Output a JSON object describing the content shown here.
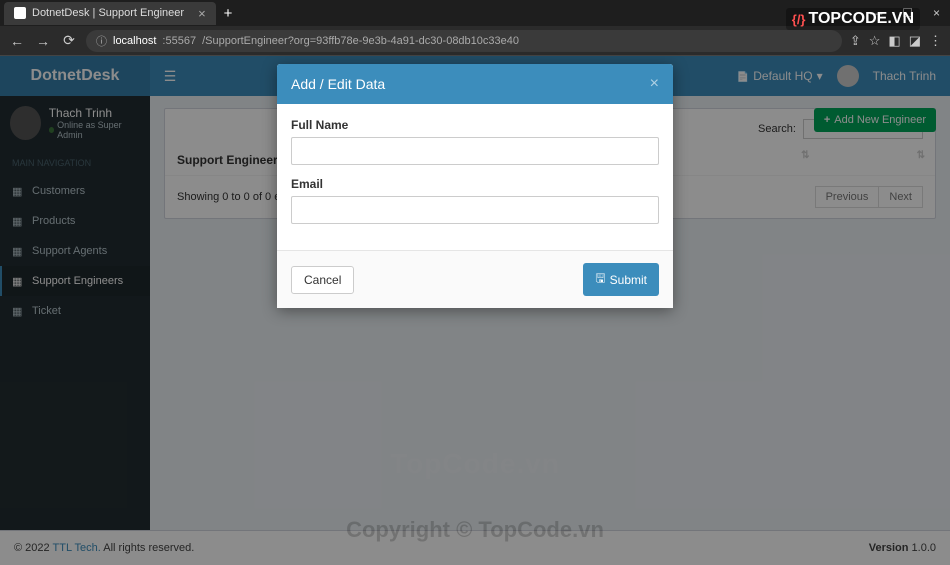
{
  "browser": {
    "tab_title": "DotnetDesk | Support Engineer",
    "url_host": "localhost",
    "url_port": ":55567",
    "url_path": "/SupportEngineer?org=93ffb78e-9e3b-4a91-dc30-08db10c33e40"
  },
  "topbar": {
    "brand": "DotnetDesk",
    "default_hq": "Default HQ",
    "user": "Thach Trinh"
  },
  "sidebar": {
    "user_name": "Thach Trinh",
    "user_status": "Online as Super Admin",
    "header": "MAIN NAVIGATION",
    "items": [
      {
        "label": "Customers"
      },
      {
        "label": "Products"
      },
      {
        "label": "Support Agents"
      },
      {
        "label": "Support Engineers"
      },
      {
        "label": "Ticket"
      }
    ]
  },
  "content": {
    "add_button": "Add New Engineer",
    "search_label": "Search:",
    "col1": "Support Engineer",
    "entries_info": "Showing 0 to 0 of 0 entries",
    "prev": "Previous",
    "next": "Next"
  },
  "modal": {
    "title": "Add / Edit Data",
    "label_fullname": "Full Name",
    "label_email": "Email",
    "cancel": "Cancel",
    "submit": "Submit"
  },
  "footer": {
    "copyright_prefix": "© 2022 ",
    "company": "TTL Tech.",
    "rights": " All rights reserved.",
    "version_label": "Version ",
    "version": "1.0.0"
  },
  "watermark": {
    "tc": "TopCode.vn",
    "cp": "Copyright © TopCode.vn",
    "logo": "TOPCODE.VN"
  }
}
